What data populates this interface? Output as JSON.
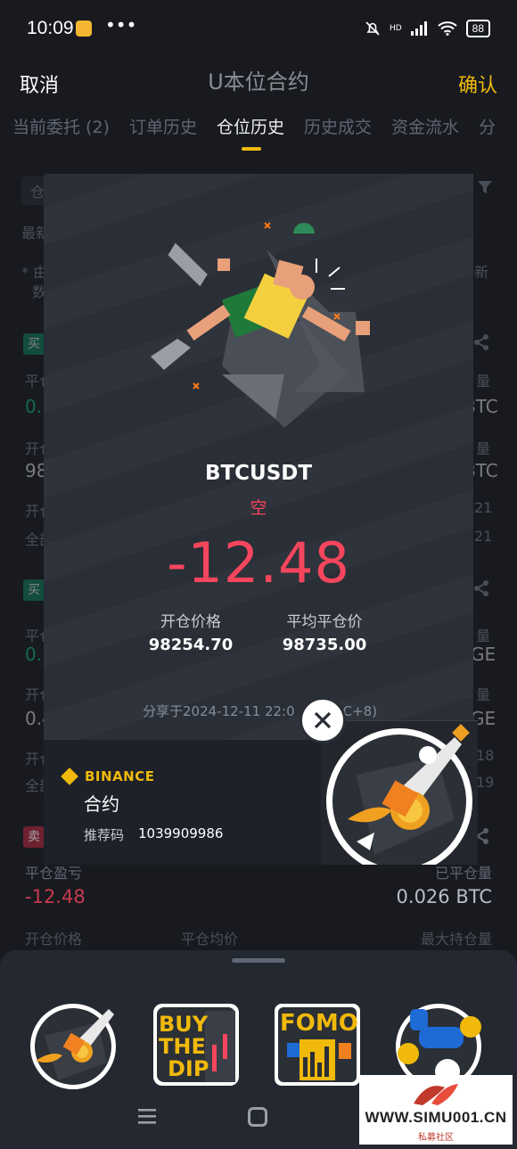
{
  "status_bar": {
    "time": "10:09",
    "dots": "•••",
    "battery": "88",
    "hd": "HD"
  },
  "header": {
    "cancel": "取消",
    "title": "U本位合约",
    "confirm": "确认"
  },
  "tabs": [
    "当前委托 (2)",
    "订单历史",
    "仓位历史",
    "历史成交",
    "资金流水",
    "分"
  ],
  "background": {
    "filter_chip": "仓",
    "latest": "最新",
    "note_a": "* 由",
    "note_b": "数",
    "note_right": "新",
    "rows": [
      {
        "tag": "买",
        "label_pnl": "平仓",
        "pnl_frag": "0.",
        "right_label": "量",
        "right_val": "BTC",
        "open_label": "开仓",
        "open_val": "98",
        "time_label": "开仓",
        "full_label": "全部",
        "time_a": "21",
        "time_b": "21"
      },
      {
        "tag": "买",
        "label_pnl": "平仓",
        "pnl_frag": "0.",
        "right_label": "量",
        "right_val": "GE",
        "open_label": "开仓",
        "open_val": "0.4",
        "time_label": "开仓",
        "full_label": "全部",
        "time_a": "18",
        "time_b": "19"
      }
    ],
    "last_row": {
      "tag": "卖",
      "pnl_label": "平仓盈亏",
      "pnl": "-12.48",
      "closed_label": "已平仓量",
      "closed_val": "0.026 BTC",
      "open_price_label": "开仓价格",
      "close_avg_label": "平仓均价",
      "max_pos_label": "最大持仓量"
    }
  },
  "card": {
    "symbol": "BTCUSDT",
    "side": "空",
    "pnl": "-12.48",
    "open_price_label": "开仓价格",
    "open_price": "98254.70",
    "close_price_label": "平均平仓价",
    "close_price": "98735.00",
    "shared_at": "分享于2024-12-11 22:0",
    "shared_at_tail": "C+8)",
    "brand": "BINANCE",
    "brand_sub": "合约",
    "referral_label": "推荐码",
    "referral_code": "1039909986"
  },
  "stickers": [
    "rocket-coin-sticker",
    "buy-the-dip-sticker",
    "fomo-sticker",
    "blue-hand-coins-sticker"
  ],
  "sticker_text": {
    "buy": "BUY",
    "the": "THE",
    "dip": "DIP",
    "fomo": "FOMO"
  },
  "watermark": {
    "text": "WWW.SIMU001.CN",
    "sub": "私募社区"
  },
  "colors": {
    "accent": "#f0b90b",
    "loss": "#f6465d",
    "bg": "#181a20"
  }
}
